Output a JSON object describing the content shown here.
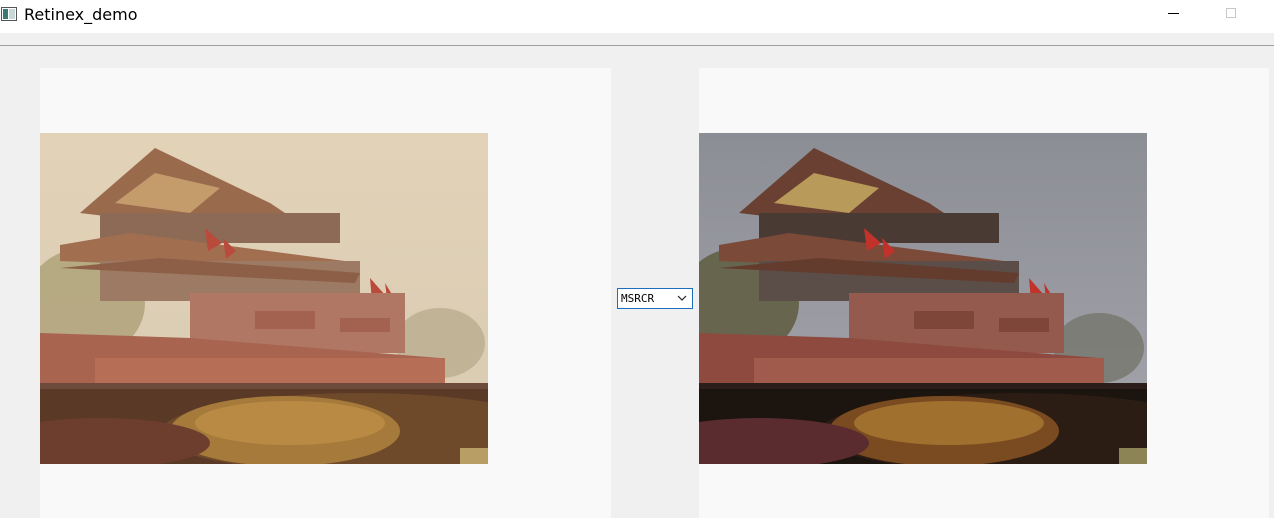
{
  "window": {
    "title": "Retinex_demo"
  },
  "algorithm_select": {
    "selected": "MSRCR"
  },
  "icons": {
    "app": "app-window-icon",
    "minimize": "minimize-icon",
    "maximize": "maximize-icon",
    "dropdown": "chevron-down-icon"
  },
  "images": {
    "original": {
      "description": "hazy photo of Tiananmen gate with red flags and shrubs"
    },
    "processed": {
      "description": "enhanced photo of Tiananmen gate with red flags and shrubs"
    }
  },
  "colors": {
    "select_border": "#1c6fbf",
    "panel_bg": "#f9f9f9",
    "window_bg": "#f0f0f0"
  }
}
